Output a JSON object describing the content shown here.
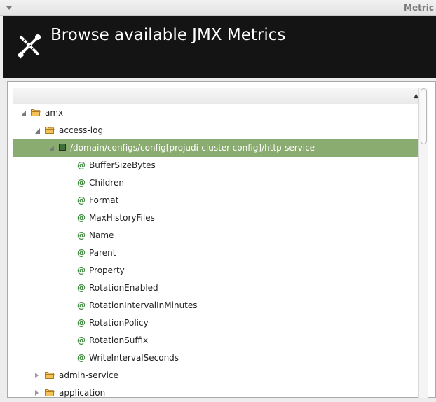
{
  "window": {
    "title": "Metric"
  },
  "header": {
    "heading": "Browse available JMX Metrics"
  },
  "tree": {
    "column_header": "",
    "rows": [
      {
        "label": "amx",
        "level": 0,
        "kind": "folder",
        "expanded": true
      },
      {
        "label": "access-log",
        "level": 1,
        "kind": "folder",
        "expanded": true
      },
      {
        "label": "/domain/configs/config[projudi-cluster-config]/http-service",
        "level": 2,
        "kind": "bean",
        "expanded": true,
        "selected": true
      },
      {
        "label": "BufferSizeBytes",
        "level": 3,
        "kind": "attribute"
      },
      {
        "label": "Children",
        "level": 3,
        "kind": "attribute"
      },
      {
        "label": "Format",
        "level": 3,
        "kind": "attribute"
      },
      {
        "label": "MaxHistoryFiles",
        "level": 3,
        "kind": "attribute"
      },
      {
        "label": "Name",
        "level": 3,
        "kind": "attribute"
      },
      {
        "label": "Parent",
        "level": 3,
        "kind": "attribute"
      },
      {
        "label": "Property",
        "level": 3,
        "kind": "attribute"
      },
      {
        "label": "RotationEnabled",
        "level": 3,
        "kind": "attribute"
      },
      {
        "label": "RotationIntervalInMinutes",
        "level": 3,
        "kind": "attribute"
      },
      {
        "label": "RotationPolicy",
        "level": 3,
        "kind": "attribute"
      },
      {
        "label": "RotationSuffix",
        "level": 3,
        "kind": "attribute"
      },
      {
        "label": "WriteIntervalSeconds",
        "level": 3,
        "kind": "attribute"
      },
      {
        "label": "admin-service",
        "level": 1,
        "kind": "folder",
        "expanded": false
      },
      {
        "label": "application",
        "level": 1,
        "kind": "folder",
        "expanded": false
      }
    ]
  },
  "icons": {
    "window_menu": "chevron-down-icon",
    "logo": "tools-icon",
    "folder": "folder-open-icon",
    "bean": "mbean-icon",
    "attribute": "attribute-at-icon",
    "sort": "sort-ascending-icon"
  },
  "colors": {
    "banner_bg": "#141414",
    "selection": "#8aac70",
    "attribute_icon": "#3d8a3d",
    "folder": "#e8a43a"
  }
}
